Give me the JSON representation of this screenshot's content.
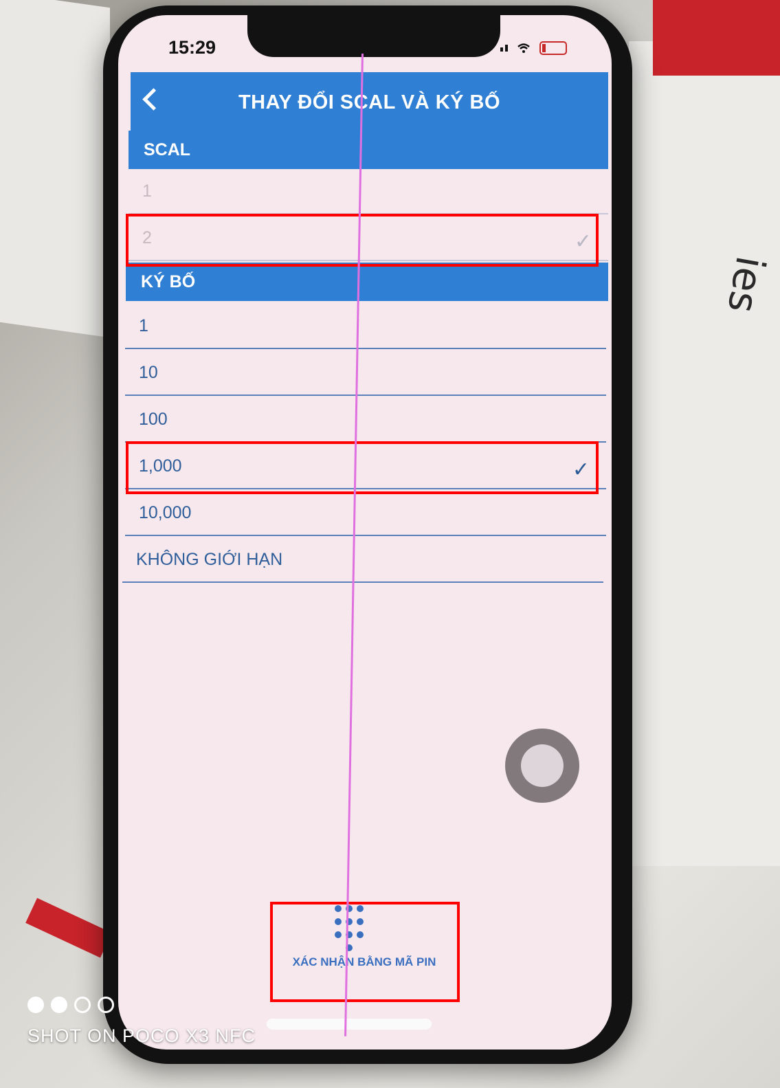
{
  "status_bar": {
    "time": "15:29"
  },
  "header": {
    "title": "THAY ĐỔI SCAL VÀ KÝ BỐ"
  },
  "scal_section": {
    "label": "SCAL",
    "items": [
      {
        "label": "1",
        "selected": false
      },
      {
        "label": "2",
        "selected": true
      }
    ]
  },
  "kybo_section": {
    "label": "KÝ BỐ",
    "items": [
      {
        "label": "1",
        "selected": false
      },
      {
        "label": "10",
        "selected": false
      },
      {
        "label": "100",
        "selected": false
      },
      {
        "label": "1,000",
        "selected": true
      },
      {
        "label": "10,000",
        "selected": false
      },
      {
        "label": "KHÔNG GIỚI HẠN",
        "selected": false
      }
    ]
  },
  "footer": {
    "pin_button_label": "XÁC NHẬN BẰNG MÃ PIN"
  },
  "camera_overlay": {
    "watermark": "SHOT ON POCO X3 NFC"
  },
  "background": {
    "paper_text": "ies"
  },
  "colors": {
    "header_blue": "#2f7fd4",
    "highlight_red": "#ff0000",
    "screen_bg": "#f6e8ec"
  }
}
